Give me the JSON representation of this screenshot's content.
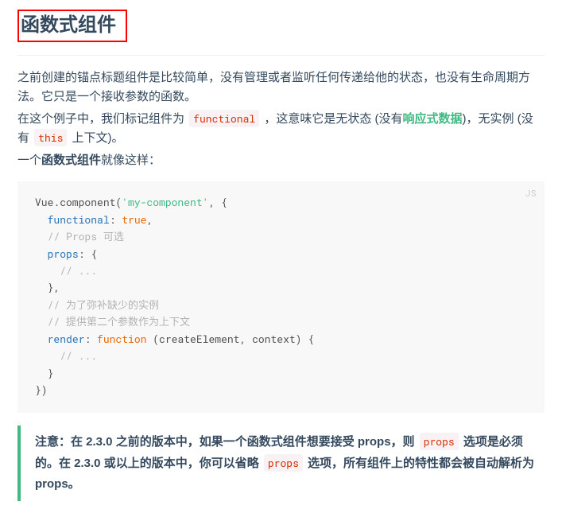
{
  "heading": "函数式组件",
  "para1a": "之前创建的锚点标题组件是比较简单，没有管理或者监听任何传递给他的状态，也没有生命周期方法。它只是一个接收参数的函数。",
  "para2_pre": "在这个例子中，我们标记组件为 ",
  "para2_code": "functional",
  "para2_mid": " ，这意味它是无状态 (没有",
  "para2_link": "响应式数据",
  "para2_after_link": ")，无实例 (没有 ",
  "para2_code2": "this",
  "para2_end": " 上下文)。",
  "para3_pre": "一个",
  "para3_bold": "函数式组件",
  "para3_end": "就像这样：",
  "code": {
    "lang": "JS",
    "l1a": "Vue.component(",
    "l1str": "'my-component'",
    "l1b": ", {",
    "l2key": "functional",
    "l2mid": ": ",
    "l2kw": "true",
    "l2end": ",",
    "l3com": "// Props 可选",
    "l4key": "props",
    "l4end": ": {",
    "l5com": "// ...",
    "l6": "},",
    "l7com": "// 为了弥补缺少的实例",
    "l8com": "// 提供第二个参数作为上下文",
    "l9key": "render",
    "l9mid": ": ",
    "l9kw": "function",
    "l9rest": " (createElement, context) {",
    "l10com": "// ...",
    "l11": "}",
    "l12": "})"
  },
  "note_pre": "注意：在 2.3.0 之前的版本中，如果一个函数式组件想要接受 props，则 ",
  "note_code1": "props",
  "note_mid": " 选项是必须的。在 2.3.0 或以上的版本中，你可以省略 ",
  "note_code2": "props",
  "note_end": " 选项，所有组件上的特性都会被自动解析为 props。"
}
